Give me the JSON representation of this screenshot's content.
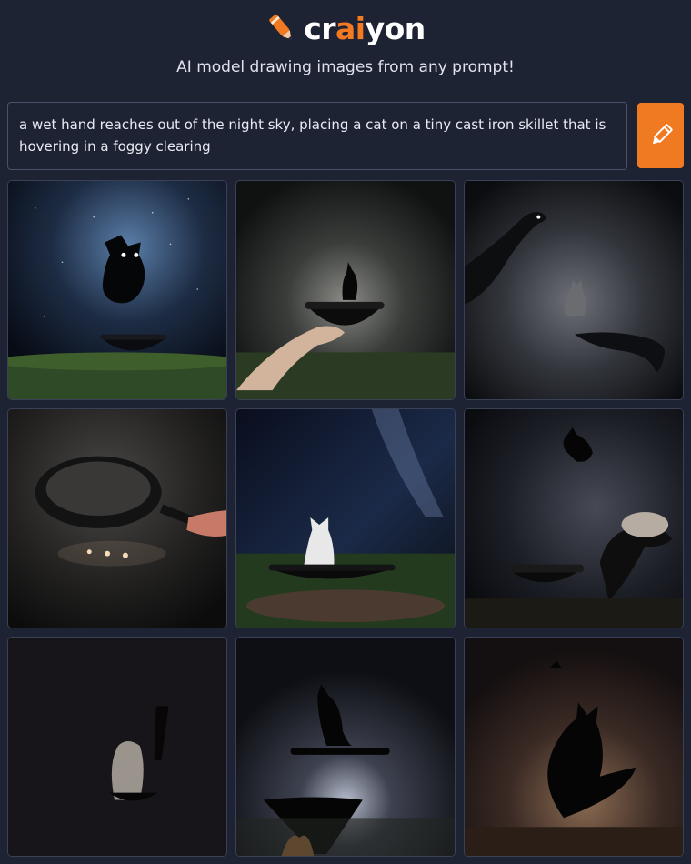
{
  "header": {
    "logo_prefix": "cr",
    "logo_accent": "ai",
    "logo_suffix": "yon",
    "tagline": "AI model drawing images from any prompt!"
  },
  "prompt": {
    "value": "a wet hand reaches out of the night sky, placing a cat on a tiny cast iron skillet that is hovering in a foggy clearing",
    "submit_icon": "pencil-icon"
  },
  "colors": {
    "background": "#1e2334",
    "accent": "#f07a22"
  },
  "gallery": {
    "images": [
      {
        "name": "generated-image-1"
      },
      {
        "name": "generated-image-2"
      },
      {
        "name": "generated-image-3"
      },
      {
        "name": "generated-image-4"
      },
      {
        "name": "generated-image-5"
      },
      {
        "name": "generated-image-6"
      },
      {
        "name": "generated-image-7"
      },
      {
        "name": "generated-image-8"
      },
      {
        "name": "generated-image-9"
      }
    ]
  }
}
